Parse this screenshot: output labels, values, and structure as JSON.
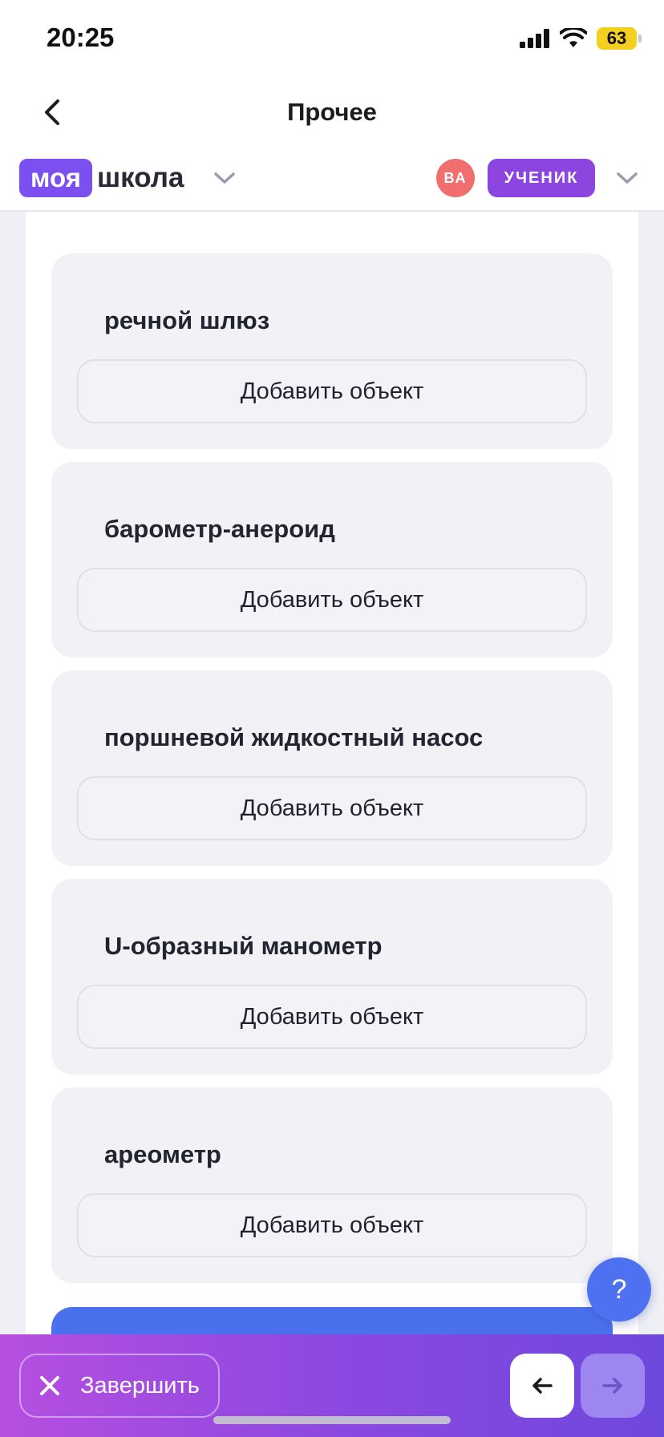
{
  "status_bar": {
    "time": "20:25",
    "battery": "63"
  },
  "nav": {
    "title": "Прочее"
  },
  "brand": {
    "logo_highlight": "моя",
    "logo_rest": "школа",
    "avatar_initials": "ВА",
    "role": "УЧЕНИК"
  },
  "cards": [
    {
      "title": "речной шлюз",
      "button": "Добавить объект"
    },
    {
      "title": "барометр-анероид",
      "button": "Добавить объект"
    },
    {
      "title": "поршневой жидкостный насос",
      "button": "Добавить объект"
    },
    {
      "title": "U-образный манометр",
      "button": "Добавить объект"
    },
    {
      "title": "ареометр",
      "button": "Добавить объект"
    }
  ],
  "help": {
    "label": "?"
  },
  "bottom": {
    "finish_label": "Завершить"
  },
  "colors": {
    "accent": "#7b4ff0",
    "role_badge": "#8d45e0",
    "avatar": "#f06e6e",
    "primary_blue": "#4a70ee"
  },
  "icons": [
    "chevron-left-icon",
    "chevron-down-icon",
    "close-icon",
    "arrow-left-icon",
    "arrow-right-icon",
    "signal-icon",
    "wifi-icon",
    "battery-icon"
  ]
}
